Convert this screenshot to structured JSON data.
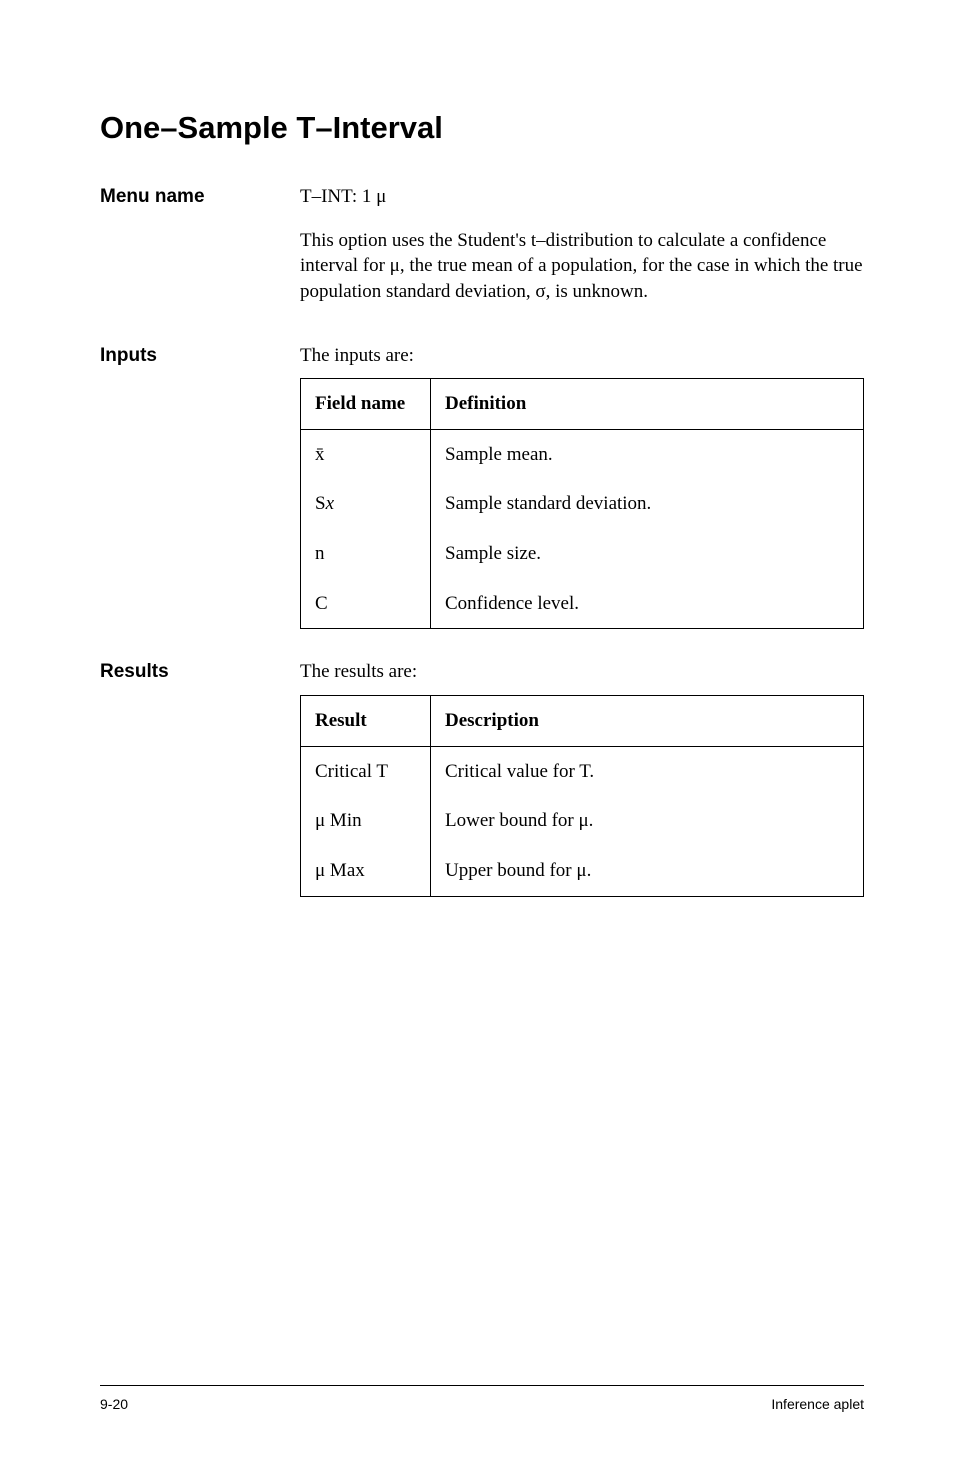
{
  "title": "One–Sample T–Interval",
  "menu": {
    "label": "Menu name",
    "value": "T–INT: 1 μ",
    "description": "This option uses the Student's t–distribution to calculate a confidence interval for μ, the true mean of a population, for the case in which the true population standard deviation, σ, is unknown."
  },
  "inputs": {
    "label": "Inputs",
    "intro": "The inputs are:",
    "headers": {
      "field": "Field name",
      "definition": "Definition"
    },
    "rows": [
      {
        "field": "x̄",
        "definition": "Sample mean."
      },
      {
        "field_html": "S<span class=\"italic\">x</span>",
        "definition": "Sample standard deviation."
      },
      {
        "field": "n",
        "definition": "Sample size."
      },
      {
        "field": "C",
        "definition": "Confidence level."
      }
    ]
  },
  "results": {
    "label": "Results",
    "intro": "The results are:",
    "headers": {
      "result": "Result",
      "description": "Description"
    },
    "rows": [
      {
        "result": "Critical T",
        "description": "Critical value for T."
      },
      {
        "result": "μ Min",
        "description": "Lower bound for μ."
      },
      {
        "result": "μ Max",
        "description": "Upper bound for μ."
      }
    ]
  },
  "footer": {
    "left": "9-20",
    "right": "Inference aplet"
  }
}
